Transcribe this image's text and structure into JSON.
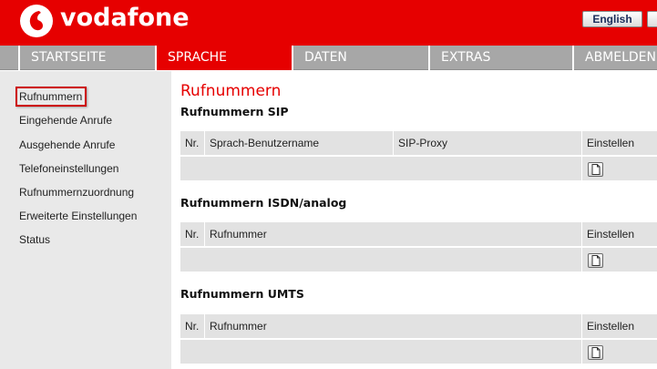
{
  "header": {
    "logo_text": "vodafone",
    "language_button": "English",
    "brand_color": "#e60000"
  },
  "nav": {
    "items": [
      {
        "label": "STARTSEITE"
      },
      {
        "label": "SPRACHE",
        "active": true
      },
      {
        "label": "DATEN"
      },
      {
        "label": "EXTRAS"
      },
      {
        "label": "ABMELDEN"
      }
    ]
  },
  "sidebar": {
    "items": [
      {
        "label": "Rufnummern",
        "selected": true
      },
      {
        "label": "Eingehende Anrufe"
      },
      {
        "label": "Ausgehende Anrufe"
      },
      {
        "label": "Telefoneinstellungen"
      },
      {
        "label": "Rufnummernzuordnung"
      },
      {
        "label": "Erweiterte Einstellungen"
      },
      {
        "label": "Status"
      }
    ]
  },
  "main": {
    "title": "Rufnummern",
    "sections": [
      {
        "title": "Rufnummern SIP",
        "columns": [
          "Nr.",
          "Sprach-Benutzername",
          "SIP-Proxy",
          "Einstellen"
        ],
        "edit_icon": "document-edit-icon"
      },
      {
        "title": "Rufnummern ISDN/analog",
        "columns": [
          "Nr.",
          "Rufnummer",
          "Einstellen"
        ],
        "edit_icon": "document-edit-icon"
      },
      {
        "title": "Rufnummern UMTS",
        "columns": [
          "Nr.",
          "Rufnummer",
          "Einstellen"
        ],
        "edit_icon": "document-edit-icon"
      }
    ]
  }
}
